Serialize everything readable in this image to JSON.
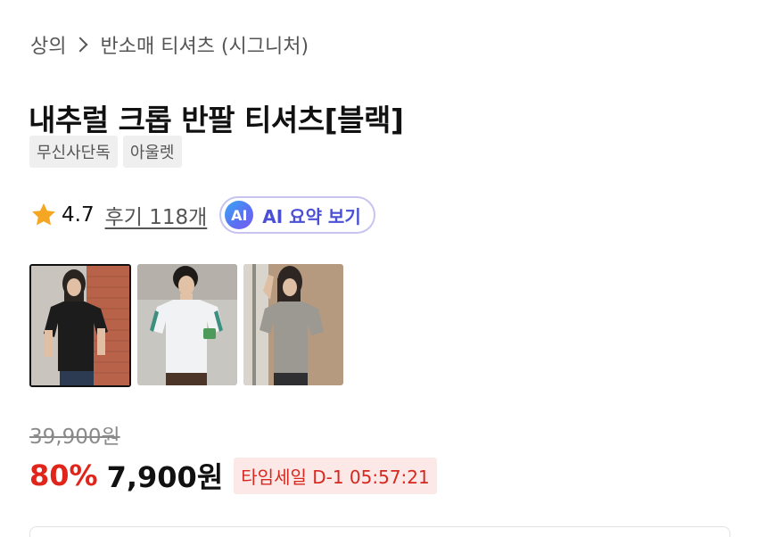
{
  "breadcrumb": {
    "parent": "상의",
    "current": "반소매 티셔츠 (시그니처)"
  },
  "product": {
    "title": "내추럴 크롭 반팔 티셔츠[블랙]",
    "tags": [
      "무신사단독",
      "아울렛"
    ],
    "rating": "4.7",
    "review_link": "후기 118개",
    "ai_button": {
      "badge": "AI",
      "label": "AI 요약 보기"
    }
  },
  "thumbnails": [
    {
      "color": "black",
      "selected": true
    },
    {
      "color": "white",
      "selected": false
    },
    {
      "color": "gray",
      "selected": false
    }
  ],
  "pricing": {
    "original_price": "39,900원",
    "discount": "80%",
    "sale_price": "7,900원",
    "time_sale": "타임세일 D-1 05:57:21"
  },
  "colors": {
    "discount": "#e1251b",
    "time_sale_bg": "#fde8e8",
    "time_sale_text": "#d6281f",
    "ai_accent": "#4a4fd6",
    "star": "#f5a623"
  },
  "icons": {
    "breadcrumb_separator": "chevron-right-icon",
    "rating": "star-icon"
  }
}
